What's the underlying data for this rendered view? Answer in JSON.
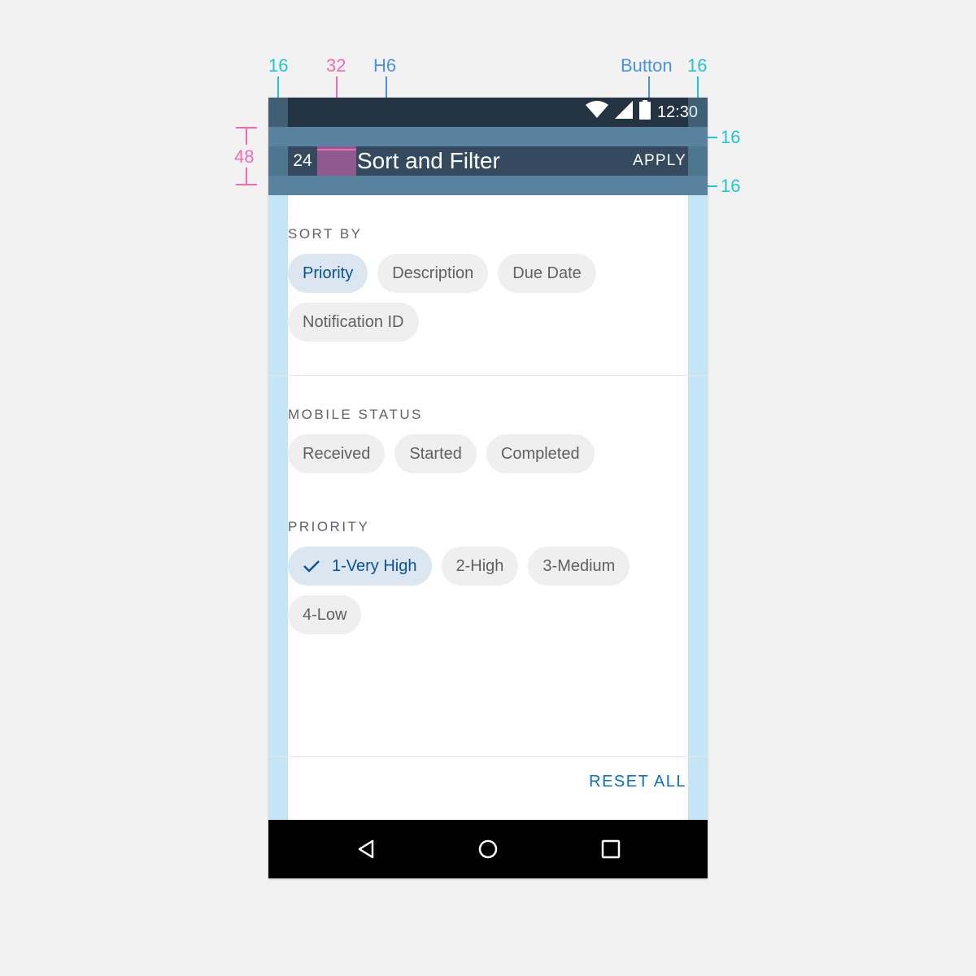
{
  "redlines": {
    "margin_left": "16",
    "icon_spacing": "32",
    "title_style": "H6",
    "button_style": "Button",
    "margin_right": "16",
    "bar_height": "48",
    "padding_top": "16",
    "padding_bottom": "16",
    "icon_size": "24"
  },
  "status_bar": {
    "time": "12:30"
  },
  "app_bar": {
    "title": "Sort and Filter",
    "action": "APPLY"
  },
  "sections": {
    "sort_by": {
      "title": "SORT BY",
      "chips": [
        {
          "label": "Priority",
          "selected": true
        },
        {
          "label": "Description",
          "selected": false
        },
        {
          "label": "Due Date",
          "selected": false
        },
        {
          "label": "Notification ID",
          "selected": false
        }
      ]
    },
    "mobile_status": {
      "title": "MOBILE STATUS",
      "chips": [
        {
          "label": "Received",
          "selected": false
        },
        {
          "label": "Started",
          "selected": false
        },
        {
          "label": "Completed",
          "selected": false
        }
      ]
    },
    "priority": {
      "title": "PRIORITY",
      "chips": [
        {
          "label": "1-Very High",
          "selected": true,
          "icon": "check-icon"
        },
        {
          "label": "2-High",
          "selected": false
        },
        {
          "label": "3-Medium",
          "selected": false
        },
        {
          "label": "4-Low",
          "selected": false
        }
      ]
    }
  },
  "footer": {
    "reset_label": "RESET ALL"
  },
  "nav_bar": {
    "icons": [
      "back-icon",
      "home-icon",
      "recents-icon"
    ]
  },
  "colors": {
    "status_bar": "#243342",
    "app_bar": "#354a5f",
    "selected_chip_bg": "#dbe6f0",
    "selected_chip_text": "#0a5298",
    "link": "#0a6ed1",
    "redline_cyan": "#1ec6d8",
    "redline_pink": "#f26ab5",
    "redline_blue": "#4a90e2"
  }
}
